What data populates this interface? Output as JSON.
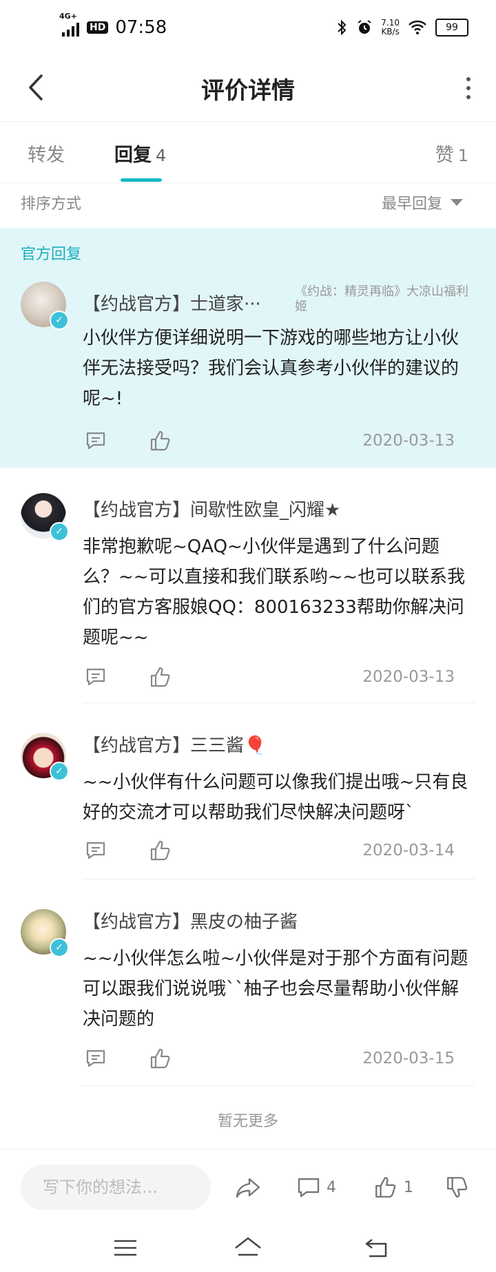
{
  "status_bar": {
    "network": "4G+",
    "hd": "HD",
    "time": "07:58",
    "speed_value": "7.10",
    "speed_unit": "KB/s",
    "battery": "99"
  },
  "header": {
    "title": "评价详情"
  },
  "tabs": [
    {
      "label": "转发",
      "count": ""
    },
    {
      "label": "回复",
      "count": "4"
    },
    {
      "label": "赞",
      "count": "1"
    }
  ],
  "sort": {
    "label": "排序方式",
    "selected": "最早回复"
  },
  "official_section": {
    "title": "官方回复",
    "reply": {
      "username": "【约战官方】士道家···",
      "game": "《约战：精灵再临》大凉山福利姬",
      "content": "小伙伴方便详细说明一下游戏的哪些地方让小伙伴无法接受吗？我们会认真参考小伙伴的建议的呢~!",
      "date": "2020-03-13"
    }
  },
  "replies": [
    {
      "username": "【约战官方】间歇性欧皇_闪耀★",
      "content": "非常抱歉呢~QAQ~小伙伴是遇到了什么问题么？~~可以直接和我们联系哟~~也可以联系我们的官方客服娘QQ：800163233帮助你解决问题呢~~",
      "date": "2020-03-13"
    },
    {
      "username": "【约战官方】三三酱🎈",
      "content": "~~小伙伴有什么问题可以像我们提出哦~只有良好的交流才可以帮助我们尽快解决问题呀`",
      "date": "2020-03-14"
    },
    {
      "username": "【约战官方】黑皮の柚子酱",
      "content": "~~小伙伴怎么啦~小伙伴是对于那个方面有问题可以跟我们说说哦``柚子也会尽量帮助小伙伴解决问题的",
      "date": "2020-03-15"
    }
  ],
  "footer": {
    "no_more": "暂无更多"
  },
  "bottom_bar": {
    "placeholder": "写下你的想法...",
    "comment_count": "4",
    "like_count": "1"
  },
  "colors": {
    "accent": "#14b9c8",
    "official_bg": "#e1f6f9"
  }
}
